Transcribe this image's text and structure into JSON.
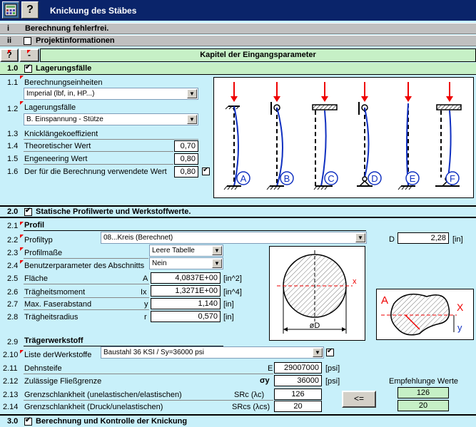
{
  "window": {
    "title": "Knickung des Stäbes"
  },
  "rows": {
    "i": {
      "num": "i",
      "label": "Berechnung fehlerfrei."
    },
    "ii": {
      "num": "ii",
      "label": "Projektinformationen"
    },
    "chapter": {
      "q": "?",
      "minus": "-",
      "label": "Kapitel der Eingangsparameter"
    }
  },
  "s1": {
    "num": "1.0",
    "title": "Lagerungsfälle",
    "r11": {
      "num": "1.1",
      "label": "Berechnungseinheiten",
      "value": "Imperial (lbf, in, HP...)"
    },
    "r12": {
      "num": "1.2",
      "label": "Lagerungsfälle",
      "value": "B. Einspannung - Stütze"
    },
    "r13": {
      "num": "1.3",
      "label": "Knicklängekoeffizient"
    },
    "r14": {
      "num": "1.4",
      "label": "Theoretischer Wert",
      "value": "0,70"
    },
    "r15": {
      "num": "1.5",
      "label": "Engeneering Wert",
      "value": "0,80"
    },
    "r16": {
      "num": "1.6",
      "label": "Der für die Berechnung verwendete Wert",
      "value": "0,80"
    },
    "cases": [
      "A",
      "B",
      "C",
      "D",
      "E",
      "F"
    ]
  },
  "s2": {
    "num": "2.0",
    "title": "Statische Profilwerte und Werkstoffwerte.",
    "r21": {
      "num": "2.1",
      "label": "Profil"
    },
    "r22": {
      "num": "2.2",
      "label": "Profiltyp",
      "value": "08...Kreis  (Berechnet)"
    },
    "r23": {
      "num": "2.3",
      "label": "Profilmaße",
      "value": "Leere Tabelle"
    },
    "r24": {
      "num": "2.4",
      "label": "Benutzerparameter des Abschnitts",
      "value": "Nein"
    },
    "r25": {
      "num": "2.5",
      "label": "Fläche",
      "sym": "A",
      "value": "4,0837E+00",
      "unit": "[in^2]"
    },
    "r26": {
      "num": "2.6",
      "label": "Trägheitsmoment",
      "sym": "Ix",
      "value": "1,3271E+00",
      "unit": "[in^4]"
    },
    "r27": {
      "num": "2.7",
      "label": "Max. Faserabstand",
      "sym": "y",
      "value": "1,140",
      "unit": "[in]"
    },
    "r28": {
      "num": "2.8",
      "label": "Trägheitsradius",
      "sym": "r",
      "value": "0,570",
      "unit": "[in]"
    },
    "d": {
      "label": "D",
      "value": "2,28",
      "unit": "[in]"
    },
    "fig1": {
      "x": "x",
      "d": "øD"
    },
    "fig2": {
      "a": "A",
      "x": "X",
      "y": "y"
    },
    "r29": {
      "num": "2.9",
      "label": "Trägerwerkstoff"
    },
    "r210": {
      "num": "2.10",
      "label": "Liste derWerkstoffe",
      "value": "Baustahl 36 KSI / Sy=36000 psi"
    },
    "r211": {
      "num": "2.11",
      "label": "Dehnsteife",
      "sym": "E",
      "value": "29007000",
      "unit": "[psi]"
    },
    "r212": {
      "num": "2.12",
      "label": "Zulässige Fließgrenze",
      "sym": "σy",
      "value": "36000",
      "unit": "[psi]"
    },
    "r213": {
      "num": "2.13",
      "label": "Grenzschlankheit (unelastischen/elastischen)",
      "sym": "SRc (λc)",
      "value": "126"
    },
    "r214": {
      "num": "2.14",
      "label": "Grenzschlankheit (Druck/unelastischen)",
      "sym": "SRcs (λcs)",
      "value": "20"
    },
    "recommended": {
      "label": "Empfehlunge Werte",
      "v1": "126",
      "v2": "20"
    },
    "apply_button": "<="
  },
  "s3": {
    "num": "3.0",
    "title": "Berechnung und Kontrolle der Knickung"
  }
}
